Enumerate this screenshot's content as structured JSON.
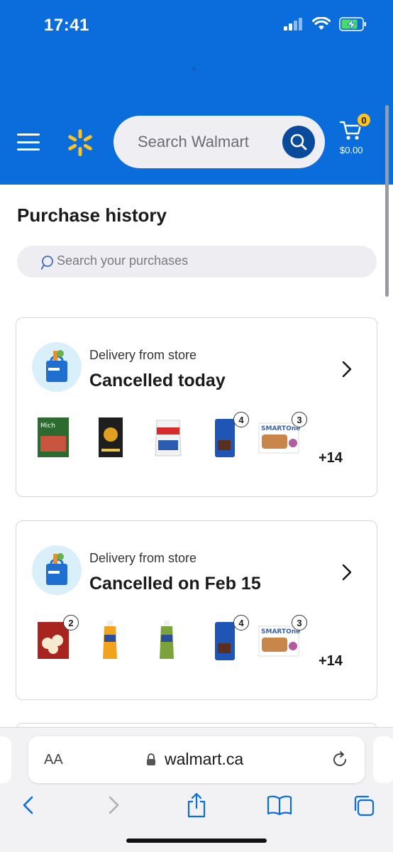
{
  "status_bar": {
    "time": "17:41"
  },
  "header": {
    "search_placeholder": "Search Walmart",
    "cart_count": "0",
    "cart_total": "$0.00",
    "brand_color": "#0a6ddb",
    "accent_color": "#ffc220"
  },
  "page": {
    "title": "Purchase history",
    "search_placeholder": "Search your purchases"
  },
  "orders": [
    {
      "subtitle": "Delivery from store",
      "status": "Cancelled today",
      "items": [
        {
          "name": "michelinas-meal",
          "qty": ""
        },
        {
          "name": "tea-box",
          "qty": ""
        },
        {
          "name": "redpath-sugar",
          "qty": ""
        },
        {
          "name": "chocolate-drink-carton",
          "qty": "4"
        },
        {
          "name": "smart-ones-meal",
          "qty": "3"
        }
      ],
      "more_count": "+14"
    },
    {
      "subtitle": "Delivery from store",
      "status": "Cancelled on Feb 15",
      "items": [
        {
          "name": "popcorn-box",
          "qty": "2"
        },
        {
          "name": "orange-juice-bottle",
          "qty": ""
        },
        {
          "name": "green-juice-bottle",
          "qty": ""
        },
        {
          "name": "chocolate-drink-carton",
          "qty": "4"
        },
        {
          "name": "smart-ones-meal",
          "qty": "3"
        }
      ],
      "more_count": "+14"
    }
  ],
  "browser": {
    "text_size_label": "AA",
    "url": "walmart.ca"
  }
}
